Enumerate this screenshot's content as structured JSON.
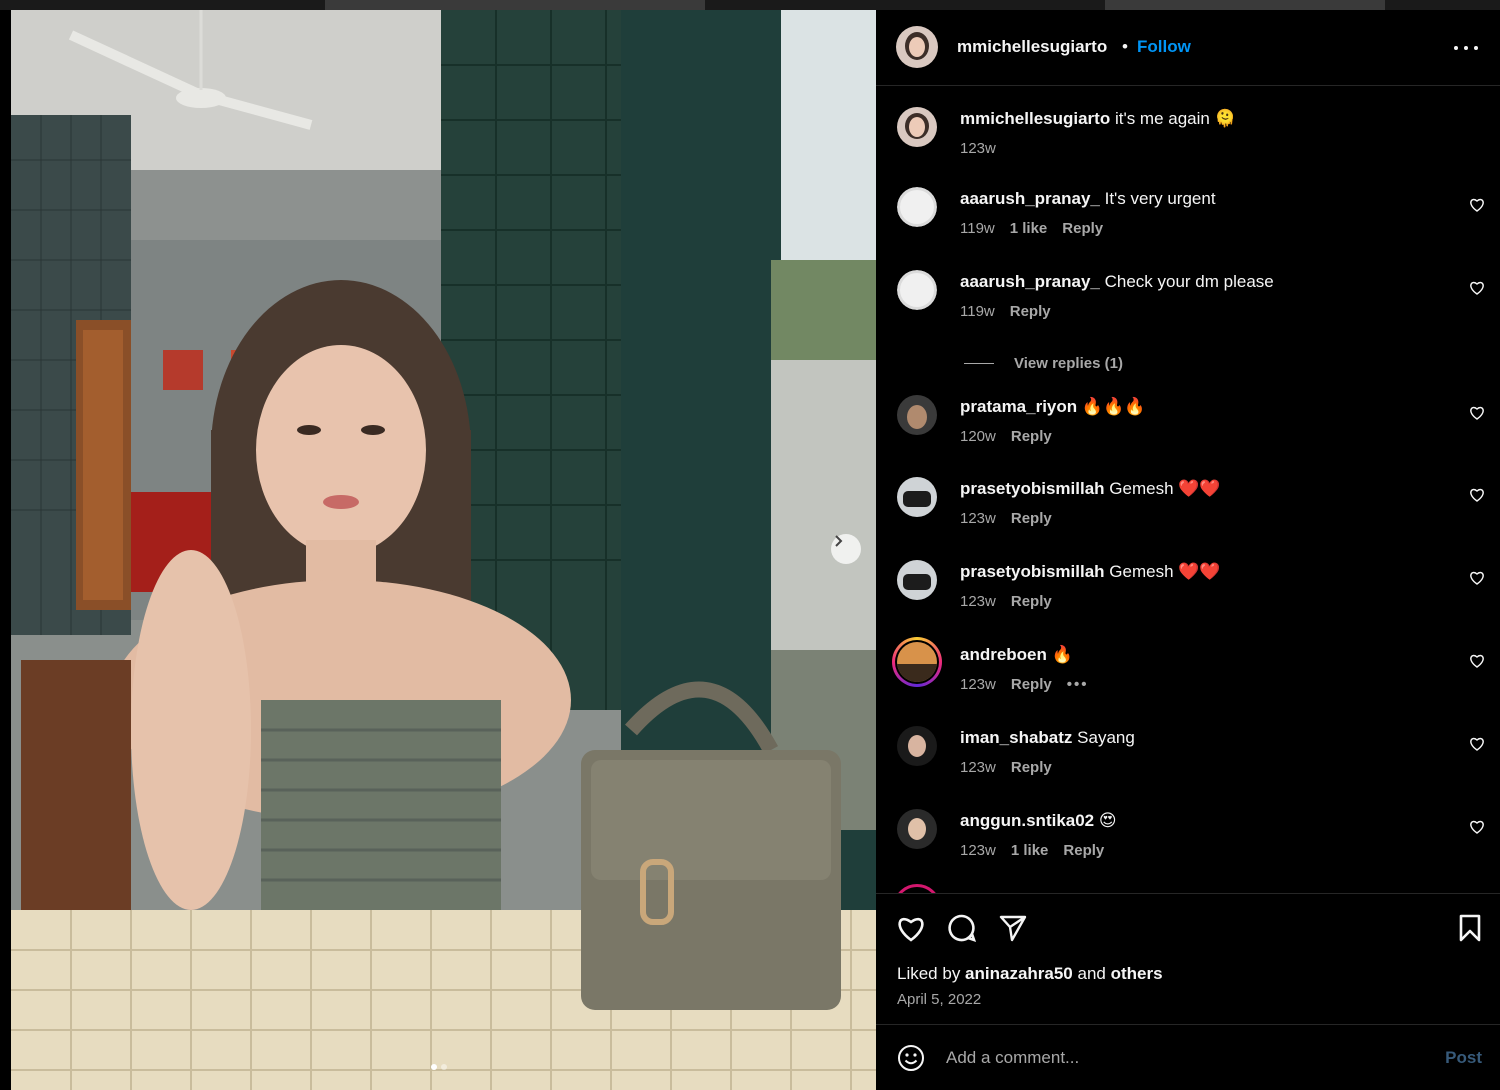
{
  "post": {
    "author": "mmichellesugiarto",
    "separator": "•",
    "follow_label": "Follow",
    "caption_text": " it's me again 🫠",
    "caption_time": "123w",
    "carousel": {
      "slide_count": 2,
      "active_slide": 1
    }
  },
  "comments": [
    {
      "user": "aaarush_pranay_",
      "text": " It's very urgent",
      "time": "119w",
      "likes": "1 like",
      "reply": "Reply"
    },
    {
      "user": "aaarush_pranay_",
      "text": " Check your dm please",
      "time": "119w",
      "likes": "",
      "reply": "Reply"
    },
    {
      "user": "pratama_riyon",
      "text": " 🔥🔥🔥",
      "time": "120w",
      "likes": "",
      "reply": "Reply"
    },
    {
      "user": "prasetyobismillah",
      "text": " Gemesh ❤️❤️",
      "time": "123w",
      "likes": "",
      "reply": "Reply"
    },
    {
      "user": "prasetyobismillah",
      "text": " Gemesh ❤️❤️",
      "time": "123w",
      "likes": "",
      "reply": "Reply"
    },
    {
      "user": "andreboen",
      "text": " 🔥",
      "time": "123w",
      "likes": "",
      "reply": "Reply",
      "more": "•••"
    },
    {
      "user": "iman_shabatz",
      "text": " Sayang",
      "time": "123w",
      "likes": "",
      "reply": "Reply"
    },
    {
      "user": "anggun.sntika02",
      "text": " 😍",
      "time": "123w",
      "likes": "1 like",
      "reply": "Reply"
    }
  ],
  "view_replies": "View replies (1)",
  "footer": {
    "liked_by_prefix": "Liked by ",
    "liked_by_user": "aninazahra50",
    "liked_by_and": " and ",
    "liked_by_others": "others",
    "date": "April 5, 2022",
    "comment_placeholder": "Add a comment...",
    "post_label": "Post"
  },
  "icons": [
    "more-horizontal-icon",
    "heart-icon",
    "comment-icon",
    "share-icon",
    "bookmark-icon",
    "emoji-icon",
    "chevron-right-icon"
  ],
  "colors": {
    "background": "#000000",
    "text": "#f5f5f5",
    "muted": "#a8a8a8",
    "follow": "#0095f6",
    "post_disabled": "#375a7a",
    "divider": "#262626"
  }
}
